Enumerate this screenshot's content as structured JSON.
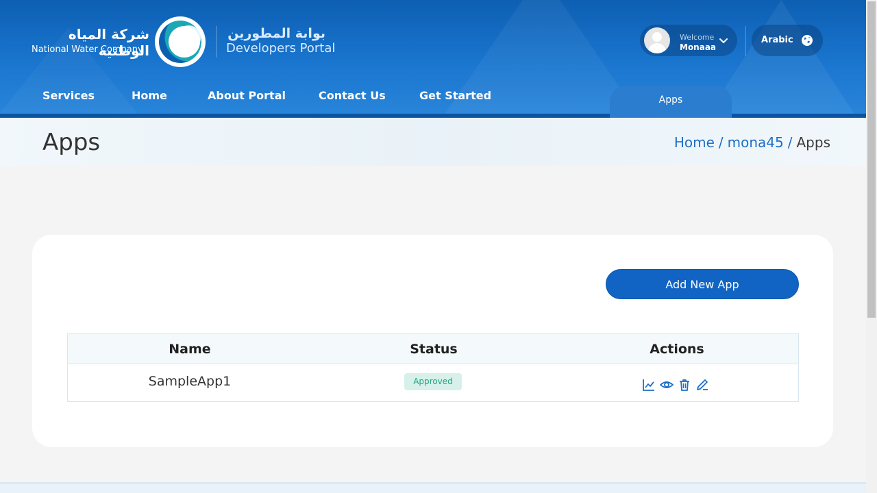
{
  "header": {
    "brand_ar": "شركة المياه الوطنية",
    "brand_en": "National Water Company",
    "portal_ar": "بوابة المطورين",
    "portal_en": "Developers Portal",
    "welcome": "Welcome",
    "username": "Monaaa",
    "language": "Arabic"
  },
  "nav": {
    "items": [
      "Services",
      "Home",
      "About Portal",
      "Contact Us",
      "Get Started"
    ],
    "active_tab": "Apps"
  },
  "page": {
    "title": "Apps",
    "breadcrumb": [
      "Home",
      "mona45",
      "Apps"
    ]
  },
  "card": {
    "add_button": "Add New App",
    "table": {
      "headers": [
        "Name",
        "Status",
        "Actions"
      ],
      "rows": [
        {
          "name": "SampleApp1",
          "status": "Approved",
          "actions": [
            "chart-icon",
            "view-icon",
            "delete-icon",
            "edit-icon"
          ]
        }
      ]
    }
  },
  "colors": {
    "primary": "#1164c3",
    "header_blue": "#1a76cf",
    "approved_bg": "#d7f1ea",
    "approved_text": "#23a27f"
  }
}
